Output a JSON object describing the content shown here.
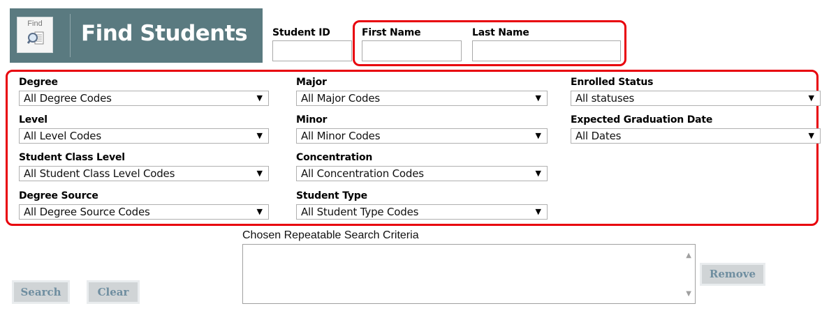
{
  "header": {
    "icon_text": "Find",
    "title": "Find Students"
  },
  "top_fields": {
    "student_id_label": "Student ID",
    "first_name_label": "First Name",
    "last_name_label": "Last Name",
    "student_id_value": "",
    "first_name_value": "",
    "last_name_value": ""
  },
  "filters": {
    "degree": {
      "label": "Degree",
      "value": "All Degree Codes"
    },
    "level": {
      "label": "Level",
      "value": "All Level Codes"
    },
    "student_class_level": {
      "label": "Student Class Level",
      "value": "All Student Class Level Codes"
    },
    "degree_source": {
      "label": "Degree Source",
      "value": "All Degree Source Codes"
    },
    "major": {
      "label": "Major",
      "value": "All Major Codes"
    },
    "minor": {
      "label": "Minor",
      "value": "All Minor Codes"
    },
    "concentration": {
      "label": "Concentration",
      "value": "All Concentration Codes"
    },
    "student_type": {
      "label": "Student Type",
      "value": "All Student Type Codes"
    },
    "enrolled_status": {
      "label": "Enrolled Status",
      "value": "All statuses"
    },
    "expected_graduation_date": {
      "label": "Expected Graduation Date",
      "value": "All Dates"
    }
  },
  "criteria": {
    "label": "Chosen Repeatable Search Criteria"
  },
  "buttons": {
    "search": "Search",
    "clear": "Clear",
    "remove": "Remove"
  },
  "colors": {
    "header_bg": "#5a7a80",
    "highlight_outline": "#e8000b",
    "button_bg": "#d0d4d6",
    "button_text": "#6f8ea0"
  }
}
